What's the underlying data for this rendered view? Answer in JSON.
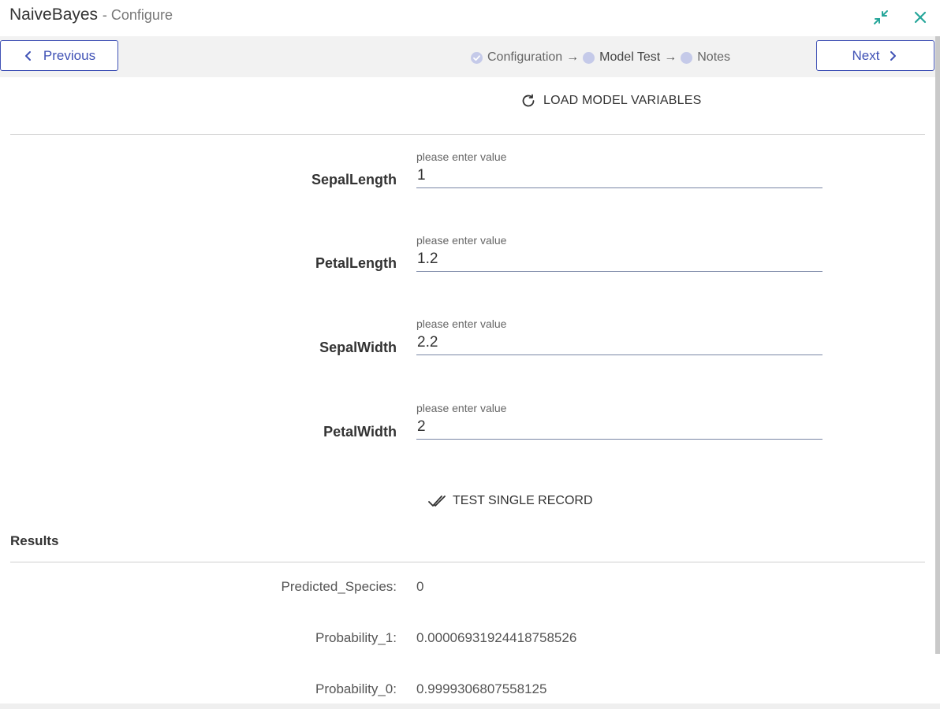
{
  "window": {
    "title": "NaiveBayes",
    "subtitle": "- Configure"
  },
  "icons": {
    "minimize": "compress-arrows-icon",
    "close": "close-x-icon",
    "accent": "#26a69a",
    "primary": "#3f51b5",
    "step_dot": "#c5cae9"
  },
  "wizard": {
    "previous_label": "Previous",
    "next_label": "Next",
    "steps": [
      {
        "label": "Configuration",
        "state": "done"
      },
      {
        "label": "Model Test",
        "state": "active"
      },
      {
        "label": "Notes",
        "state": "pending"
      }
    ],
    "arrow": "→"
  },
  "actions": {
    "load_variables": "LOAD MODEL VARIABLES",
    "test_single": "TEST SINGLE RECORD"
  },
  "fields": [
    {
      "label": "SepalLength",
      "hint": "please enter value",
      "value": "1"
    },
    {
      "label": "PetalLength",
      "hint": "please enter value",
      "value": "1.2"
    },
    {
      "label": "SepalWidth",
      "hint": "please enter value",
      "value": "2.2"
    },
    {
      "label": "PetalWidth",
      "hint": "please enter value",
      "value": "2"
    }
  ],
  "results": {
    "title": "Results",
    "rows": [
      {
        "label": "Predicted_Species:",
        "value": "0"
      },
      {
        "label": "Probability_1:",
        "value": "0.00006931924418758526"
      },
      {
        "label": "Probability_0:",
        "value": "0.9999306807558125"
      }
    ]
  }
}
